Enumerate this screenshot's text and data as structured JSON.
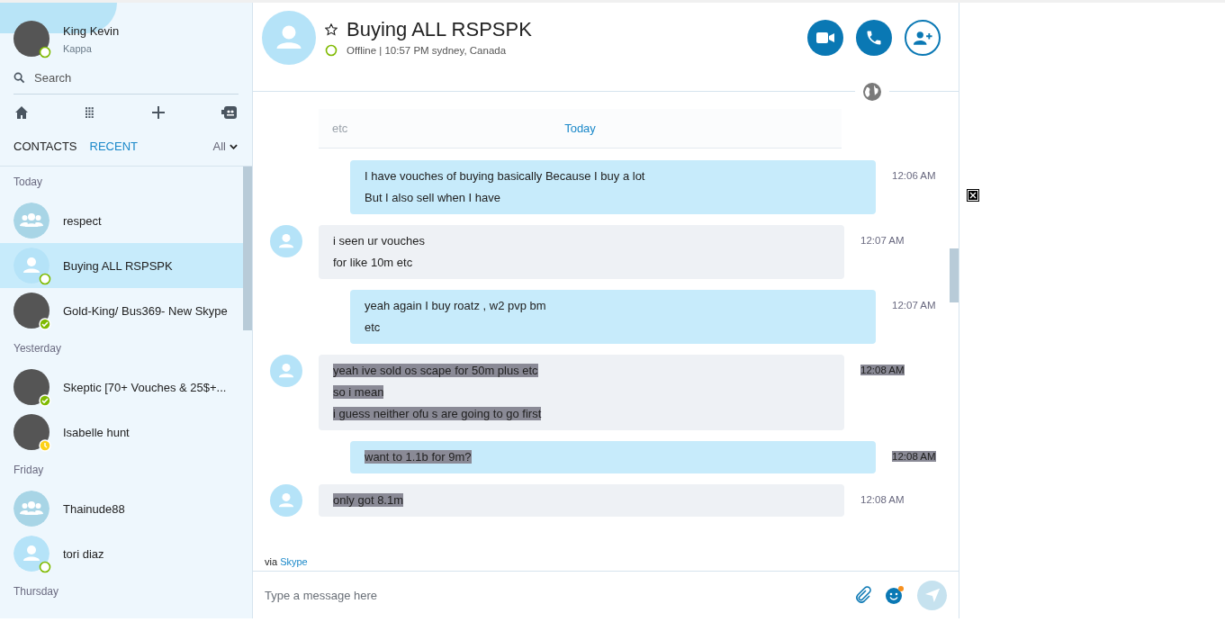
{
  "profile": {
    "name": "King Kevin",
    "mood": "Kappa",
    "online": false,
    "away": false
  },
  "search": {
    "placeholder": "Search"
  },
  "tabs": [
    {
      "label": "CONTACTS",
      "selected": false
    },
    {
      "label": "RECENT",
      "selected": true
    }
  ],
  "filter": {
    "label": "All"
  },
  "sections": [
    {
      "title": "Today",
      "items": [
        {
          "name": "respect",
          "kind": "group",
          "selected": false
        },
        {
          "name": "Buying ALL RSPSPK",
          "kind": "person",
          "online": false,
          "away": false,
          "selected": true
        },
        {
          "name": "Gold-King/ Bus369- New Skype",
          "kind": "photo",
          "online": true,
          "away": false,
          "selected": false
        }
      ]
    },
    {
      "title": "Yesterday",
      "items": [
        {
          "name": "Skeptic [70+ Vouches & 25$+...",
          "kind": "photo",
          "online": true,
          "away": false,
          "selected": false
        },
        {
          "name": "Isabelle hunt",
          "kind": "photo",
          "away": true,
          "selected": false
        }
      ]
    },
    {
      "title": "Friday",
      "items": [
        {
          "name": "Thainude88",
          "kind": "group",
          "selected": false
        },
        {
          "name": "tori diaz",
          "kind": "person",
          "online": false,
          "away": false,
          "selected": false
        }
      ]
    }
  ],
  "section_cut": {
    "title": "Thursday"
  },
  "chat": {
    "title": "Buying ALL RSPSPK",
    "favorite": false,
    "online": false,
    "presence": "Offline | 10:57 PM sydney, Canada"
  },
  "faded_message": "etc",
  "day_label": "Today",
  "messages": [
    {
      "kind": "out",
      "time": "12:06 AM",
      "time_selected": false,
      "lines": [
        {
          "text": "I have vouches of buying basically Because I buy a lot",
          "selected": false
        },
        {
          "text": "But I also sell when I have",
          "selected": false
        }
      ]
    },
    {
      "kind": "in",
      "time": "12:07 AM",
      "time_selected": false,
      "lines": [
        {
          "text": "i seen ur vouches",
          "selected": false
        },
        {
          "text": "for like 10m etc",
          "selected": false
        }
      ]
    },
    {
      "kind": "out",
      "time": "12:07 AM",
      "time_selected": false,
      "lines": [
        {
          "text": "yeah again I buy roatz , w2 pvp bm",
          "selected": false
        },
        {
          "text": "etc",
          "selected": false
        }
      ]
    },
    {
      "kind": "in",
      "time": "12:08 AM",
      "time_selected": true,
      "lines": [
        {
          "text": "yeah ive sold os scape for 50m plus etc",
          "selected": true
        },
        {
          "text": "so i mean",
          "selected": true
        },
        {
          "text": "i guess neither ofu s are going to go first",
          "selected": true
        }
      ]
    },
    {
      "kind": "out",
      "time": "12:08 AM",
      "time_selected": true,
      "lines": [
        {
          "text": "want to 1.1b for 9m?",
          "selected": true
        }
      ]
    },
    {
      "kind": "in",
      "time": "12:08 AM",
      "time_selected": false,
      "lines": [
        {
          "text": "only got 8.1m",
          "selected": true
        }
      ]
    }
  ],
  "via": {
    "prefix": "via",
    "link": "Skype"
  },
  "composer": {
    "placeholder": "Type a message here"
  }
}
